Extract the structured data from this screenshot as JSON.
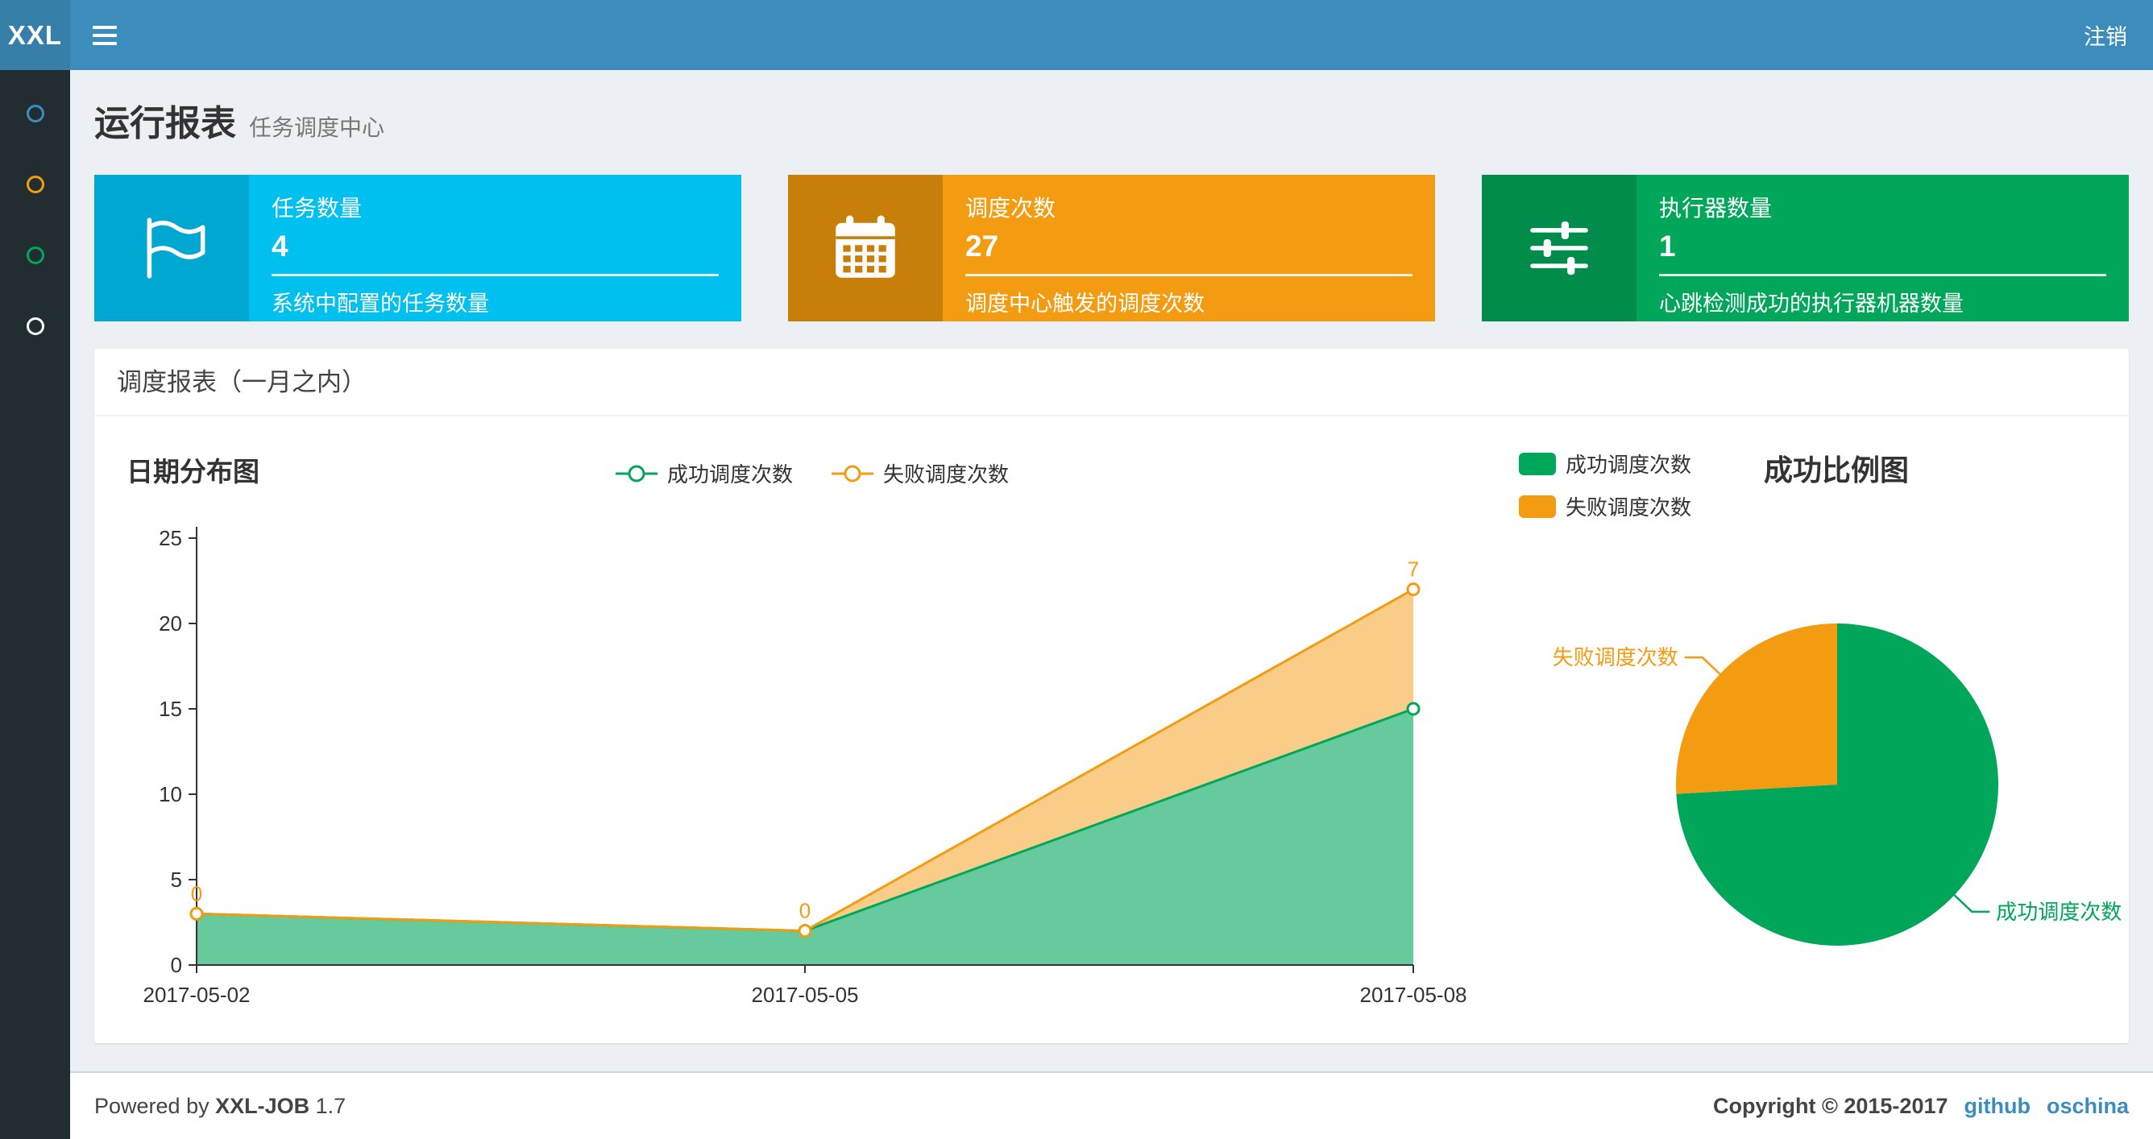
{
  "navbar": {
    "logo": "XXL",
    "logout": "注销"
  },
  "sidebar": {
    "items": [
      {
        "name": "menu-item-1",
        "color": "#3c8dbc"
      },
      {
        "name": "menu-item-2",
        "color": "#f39c12"
      },
      {
        "name": "menu-item-3",
        "color": "#00a65a"
      },
      {
        "name": "menu-item-4",
        "color": "#ffffff"
      }
    ]
  },
  "page": {
    "title": "运行报表",
    "subtitle": "任务调度中心"
  },
  "info_boxes": [
    {
      "icon": "flag-icon",
      "title": "任务数量",
      "value": "4",
      "desc": "系统中配置的任务数量",
      "color": "#00c0ef",
      "icon_color": "#00a7d0"
    },
    {
      "icon": "calendar-icon",
      "title": "调度次数",
      "value": "27",
      "desc": "调度中心触发的调度次数",
      "color": "#f39c12",
      "icon_color": "#c87f0a"
    },
    {
      "icon": "sliders-icon",
      "title": "执行器数量",
      "value": "1",
      "desc": "心跳检测成功的执行器机器数量",
      "color": "#00a65a",
      "icon_color": "#008d4c"
    }
  ],
  "panel": {
    "title": "调度报表（一月之内）"
  },
  "chart_data": [
    {
      "type": "area",
      "title": "日期分布图",
      "stacked": true,
      "x": [
        "2017-05-02",
        "2017-05-05",
        "2017-05-08"
      ],
      "series": [
        {
          "name": "成功调度次数",
          "values": [
            3,
            2,
            15
          ],
          "color": "#00a65a"
        },
        {
          "name": "失败调度次数",
          "values": [
            0,
            0,
            7
          ],
          "color": "#f39c12"
        }
      ],
      "ylim": [
        0,
        25
      ],
      "yticks": [
        0,
        5,
        10,
        15,
        20,
        25
      ],
      "point_labels": [
        "0",
        "0",
        "7"
      ],
      "legend_position": "top-center",
      "grid": false
    },
    {
      "type": "pie",
      "title": "成功比例图",
      "slices": [
        {
          "name": "成功调度次数",
          "value": 20,
          "color": "#00a65a"
        },
        {
          "name": "失败调度次数",
          "value": 7,
          "color": "#f39c12"
        }
      ],
      "legend_position": "top-left",
      "start_angle": "top",
      "direction": "clockwise"
    }
  ],
  "footer": {
    "powered_prefix": "Powered by",
    "brand": "XXL-JOB",
    "version": "1.7",
    "copyright": "Copyright © 2015-2017",
    "links": [
      {
        "label": "github"
      },
      {
        "label": "oschina"
      }
    ]
  },
  "theme": {
    "navbar_bg": "#3c8dbc",
    "logo_bg": "#367fa9",
    "sidebar_bg": "#222d32",
    "content_bg": "#ecf0f5",
    "link_color": "#3c8dbc"
  }
}
